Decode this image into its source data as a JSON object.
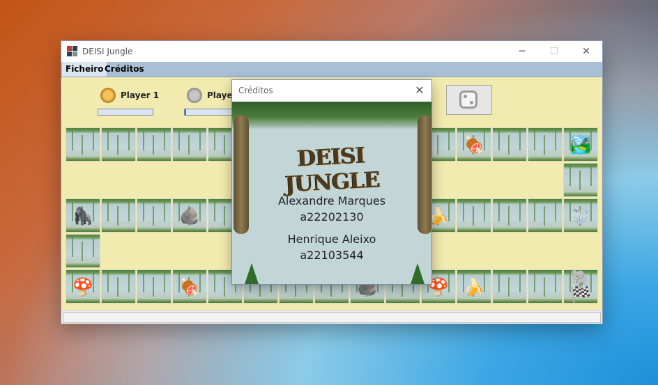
{
  "window": {
    "title": "DEISI Jungle",
    "minimize_glyph": "─",
    "maximize_glyph": "☐",
    "close_glyph": "✕"
  },
  "menu": {
    "file_label": "Ficheiro",
    "credits_label": "Créditos"
  },
  "players": [
    {
      "name": "Player 1",
      "avatar": "lion-icon",
      "energy": 1.0
    },
    {
      "name": "Player",
      "avatar": "seal-icon",
      "energy": 0.9
    }
  ],
  "dice": {
    "icon": "dice-icon",
    "face": 2
  },
  "board": {
    "cells": [
      {
        "item": ""
      },
      {
        "item": ""
      },
      {
        "item": ""
      },
      {
        "item": ""
      },
      {
        "item": ""
      },
      {
        "item": ""
      },
      {
        "item": "🍖"
      },
      {
        "item": ""
      },
      {
        "item": ""
      },
      {
        "item": "🏞️"
      },
      {
        "item": ""
      },
      {
        "item": "🦍"
      },
      {
        "item": ""
      },
      {
        "item": ""
      },
      {
        "item": "🪨"
      },
      {
        "item": ""
      },
      {
        "item": "🍌"
      },
      {
        "item": ""
      },
      {
        "item": ""
      },
      {
        "item": ""
      },
      {
        "item": "🦭"
      },
      {
        "item": ""
      },
      {
        "item": "🍄"
      },
      {
        "item": ""
      },
      {
        "item": ""
      },
      {
        "item": "🍖"
      },
      {
        "item": ""
      },
      {
        "item": ""
      },
      {
        "item": ""
      },
      {
        "item": "🪨"
      },
      {
        "item": ""
      },
      {
        "item": "🍄"
      },
      {
        "item": "🍌"
      },
      {
        "item": ""
      },
      {
        "item": ""
      },
      {
        "item": "🐘🏁"
      }
    ],
    "cell_icons": {
      "🍖": "meat-icon",
      "🏞️": "lake-icon",
      "🦍": "gorilla-icon",
      "🪨": "rock-icon",
      "🍌": "bananas-icon",
      "🦭": "seal-icon",
      "🍄": "mushroom-icon",
      "🐘🏁": "elephant-finish-icon"
    }
  },
  "credits_dialog": {
    "title": "Créditos",
    "logo_text": "DEISI JUNGLE",
    "author1_name": "Alexandre Marques",
    "author1_id": "a22202130",
    "author2_name": "Henrique Aleixo",
    "author2_id": "a22103544",
    "close_glyph": "✕"
  },
  "colors": {
    "board_background": "#f2ebaf",
    "menubar": "#a9bfd6",
    "energy_fill": "#3b6fb3"
  }
}
